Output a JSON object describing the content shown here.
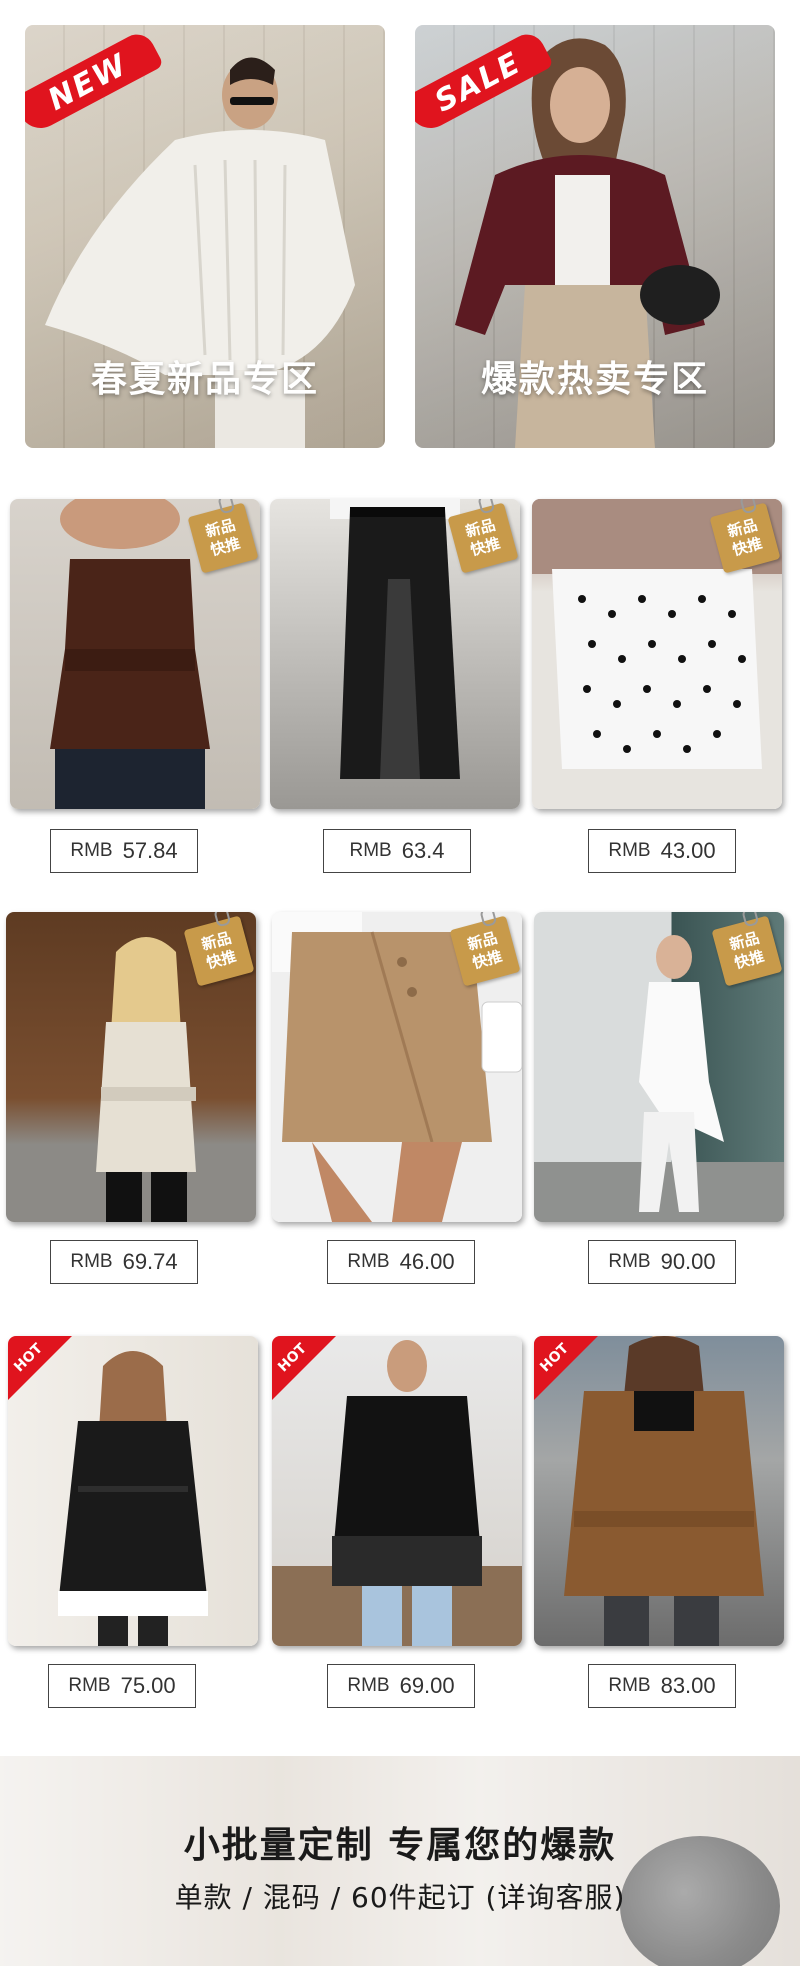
{
  "hero": {
    "new_banner": {
      "stamp": "NEW",
      "title": "春夏新品专区"
    },
    "sale_banner": {
      "stamp": "SALE",
      "title": "爆款热卖专区"
    }
  },
  "badges": {
    "new_line1": "新品",
    "new_line2": "快推",
    "hot": "HOT"
  },
  "products": [
    {
      "currency": "RMB",
      "price": "57.84"
    },
    {
      "currency": "RMB",
      "price": "63.4"
    },
    {
      "currency": "RMB",
      "price": "43.00"
    },
    {
      "currency": "RMB",
      "price": "69.74"
    },
    {
      "currency": "RMB",
      "price": "46.00"
    },
    {
      "currency": "RMB",
      "price": "90.00"
    },
    {
      "currency": "RMB",
      "price": "75.00"
    },
    {
      "currency": "RMB",
      "price": "69.00"
    },
    {
      "currency": "RMB",
      "price": "83.00"
    }
  ],
  "footer": {
    "title": "小批量定制 专属您的爆款",
    "subtitle": "单款 / 混码 / 60件起订 (详询客服)"
  },
  "colors": {
    "accent_red": "#e0141e",
    "badge_gold": "#c89a4a",
    "price_border": "#444444"
  }
}
